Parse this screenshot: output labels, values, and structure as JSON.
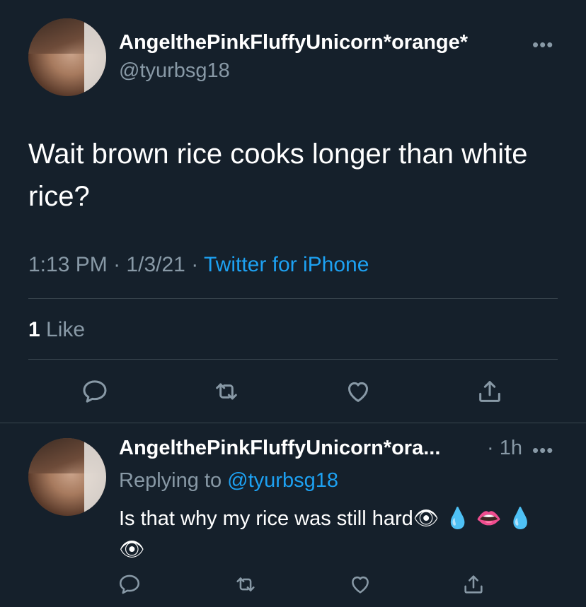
{
  "tweet": {
    "display_name": "AngelthePinkFluffyUnicorn*orange*",
    "handle": "@tyurbsg18",
    "text": "Wait brown rice cooks longer than white rice?",
    "time": "1:13 PM",
    "date": "1/3/21",
    "separator": "·",
    "source": "Twitter for iPhone",
    "like_count": "1",
    "like_label": "Like",
    "more_icon": "more-icon"
  },
  "actions": [
    "reply-icon",
    "retweet-icon",
    "like-icon",
    "share-icon"
  ],
  "reply": {
    "display_name": "AngelthePinkFluffyUnicorn*ora...",
    "time": "· 1h",
    "replying_prefix": "Replying to",
    "replying_handle": "@tyurbsg18",
    "text": "Is that why my rice was still hard👁 💧 👄 💧 👁"
  },
  "colors": {
    "background": "#15202b",
    "secondary_text": "#8899a6",
    "accent": "#1da1f2",
    "divider": "#38444d"
  }
}
